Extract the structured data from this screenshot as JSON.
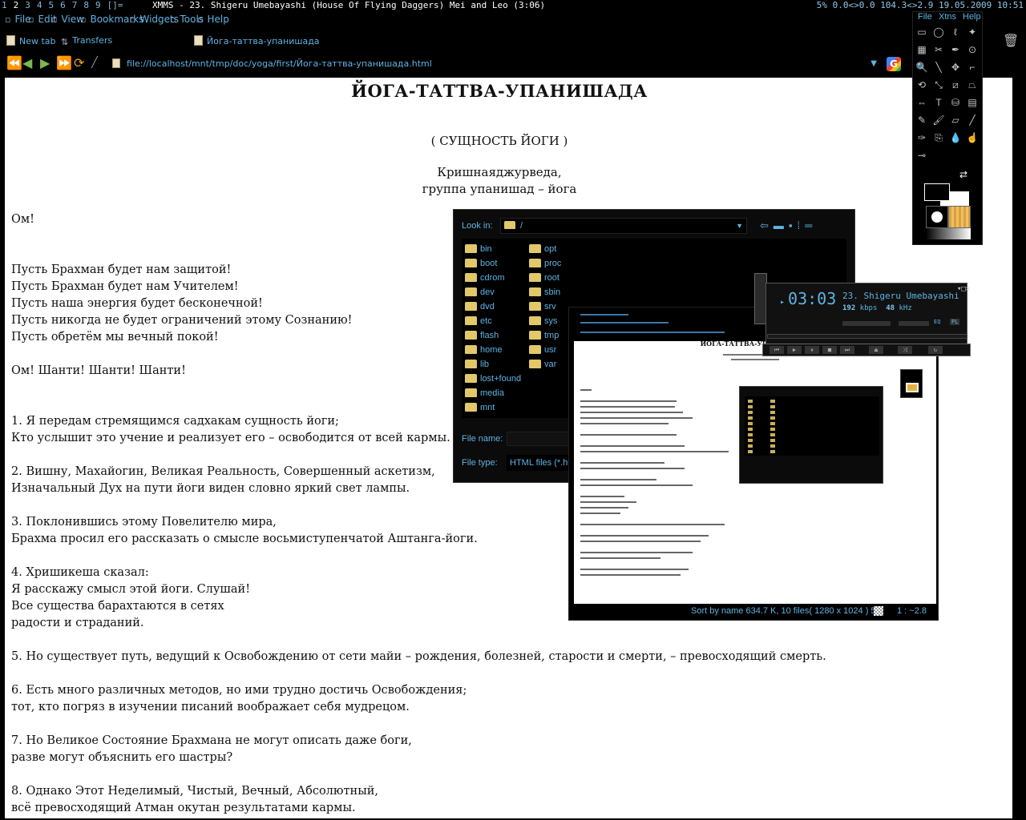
{
  "statusbar": {
    "tags": [
      "1",
      "2",
      "3",
      "4",
      "5",
      "6",
      "7",
      "8",
      "9"
    ],
    "current_tag": "2",
    "layout_symbol": "[]=",
    "window_title": "XMMS - 23. Shigeru Umebayashi (House Of Flying Daggers) Mei and Leo (3:06)",
    "sysinfo": "5% 0.0<>0.0 104.3<>2.9 19.05.2009 10:51"
  },
  "browser": {
    "menu": [
      "File",
      "Edit",
      "View",
      "Bookmarks",
      "Widgets",
      "Tools",
      "Help"
    ],
    "tabs": [
      {
        "label": "New tab",
        "icon": "page-icon"
      },
      {
        "label": "Transfers",
        "icon": "transfers-icon"
      },
      {
        "label": "Йога-таттва-упанишада",
        "icon": "page-icon"
      }
    ],
    "url": "file://localhost/mnt/tmp/doc/yoga/first/Йога-таттва-упанишада.html"
  },
  "page": {
    "title": "ЙОГА-ТАТТВА-УПАНИШАДА",
    "subtitle": "( СУЩНОСТЬ ЙОГИ )",
    "author_line1": "Кришнаяджурведа,",
    "author_line2": "группа упанишад – йога",
    "paragraphs": [
      [
        "Ом!"
      ],
      [
        "Пусть Брахман будет нам защитой!",
        "Пусть Брахман будет нам Учителем!",
        "Пусть наша энергия будет бесконечной!",
        "Пусть никогда не будет ограничений этому Сознанию!",
        "Пусть обретём мы вечный покой!"
      ],
      [
        "Ом! Шанти! Шанти! Шанти!"
      ],
      [
        "1. Я передам стремящимся садхакам сущность йоги;",
        "Кто услышит это учение и реализует его – освободится от всей кармы."
      ],
      [
        "2. Вишну, Махайогин, Великая Реальность, Совершенный аскетизм,",
        "Изначальный Дух на пути йоги виден словно яркий свет лампы."
      ],
      [
        "3. Поклонившись этому Повелителю мира,",
        "Брахма просил его рассказать о смысле восьмиступенчатой Аштанга-йоги."
      ],
      [
        "4. Хришикеша сказал:",
        "Я расскажу смысл этой йоги. Слушай!",
        "Все существа барахтаются в сетях",
        "радости и страданий."
      ],
      [
        "5. Но существует путь, ведущий к Освобождению от сети майи – рождения, болезней, старости и смерти, – превосходящий смерть."
      ],
      [
        "6. Есть много различных методов, но ими трудно достичь Освобождения;",
        "тот, кто погряз в изучении писаний воображает себя мудрецом."
      ],
      [
        "7. Но Великое Состояние Брахмана не могут описать даже боги,",
        "разве могут объяснить его шастры?"
      ],
      [
        "8. Однако Этот Неделимый, Чистый, Вечный, Абсолютный,",
        "всё превосходящий Атман окутан результатами кармы."
      ]
    ]
  },
  "file_chooser": {
    "look_in_label": "Look in:",
    "look_in_value": "/",
    "col1": [
      "bin",
      "boot",
      "cdrom",
      "dev",
      "dvd",
      "etc",
      "flash",
      "home",
      "lib",
      "lost+found",
      "media",
      "mnt"
    ],
    "col2": [
      "opt",
      "proc",
      "root",
      "sbin",
      "srv",
      "sys",
      "tmp",
      "usr",
      "var"
    ],
    "file_name_label": "File name:",
    "file_type_label": "File type:",
    "file_type_value": "HTML files (*.ht"
  },
  "image_viewer": {
    "status_left": "Sort by name 634.7 K, 10 files( 1280 x 1024 ) 5",
    "status_right": "1 : ~2.8"
  },
  "gimp": {
    "menu": [
      "File",
      "Xtns",
      "Help"
    ]
  },
  "xmms": {
    "time": "03:03",
    "title": "23. Shigeru Umebayashi (House Of Flying Daggers)",
    "kbps": "192",
    "khz": "48",
    "kbps_unit": "kbps",
    "khz_unit": "kHz",
    "eq_label": "EQ",
    "pl_label": "PL"
  },
  "colors": {
    "accent": "#5fb3e3",
    "background": "#000000",
    "page_bg": "#ffffff",
    "folder": "#e2c86a"
  }
}
